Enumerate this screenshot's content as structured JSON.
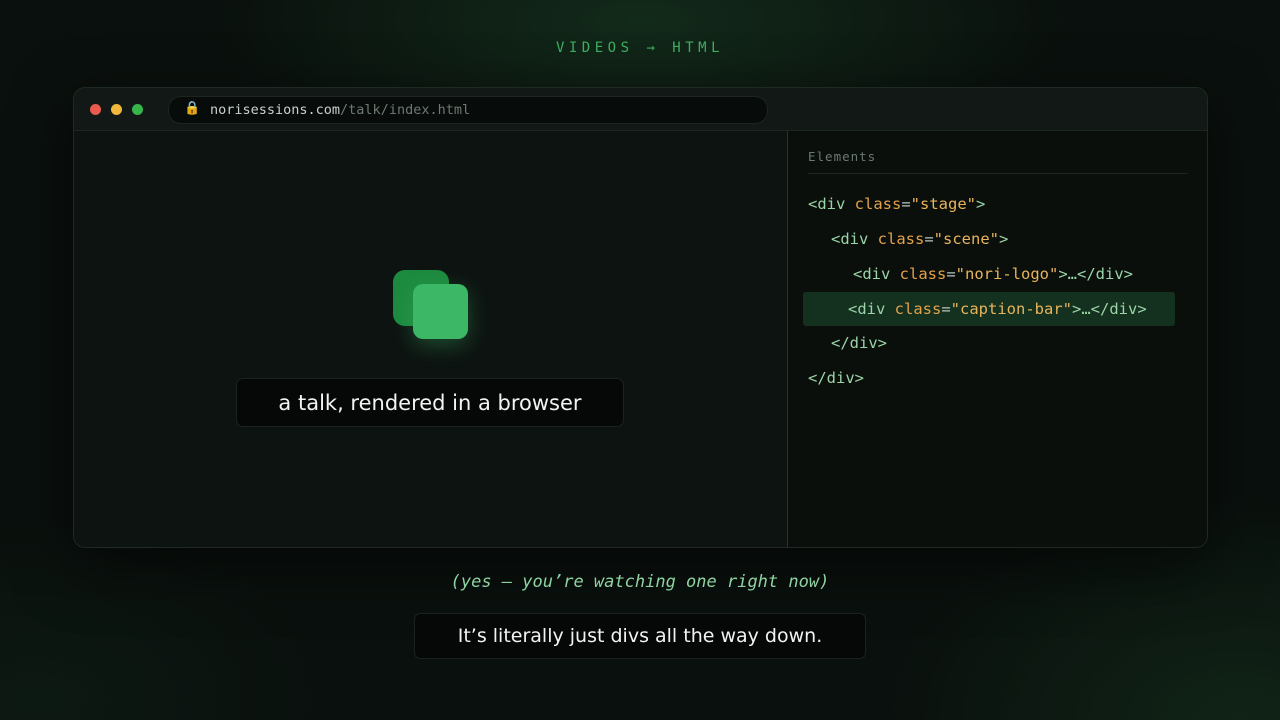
{
  "header": {
    "label": "VIDEOS → HTML"
  },
  "browser": {
    "url_host": "norisessions.com",
    "url_path": "/talk/index.html",
    "lock_icon": "lock-icon",
    "window_controls": [
      "close",
      "minimize",
      "maximize"
    ]
  },
  "viewport": {
    "logo_icon": "nori-logo-icon",
    "caption": "a talk, rendered in a browser"
  },
  "devtools": {
    "panel_label": "Elements",
    "lines": [
      {
        "open": "<div",
        "attr": " class",
        "eq": "=",
        "val": "\"stage\"",
        "close": ">"
      },
      {
        "open": "<div",
        "attr": " class",
        "eq": "=",
        "val": "\"scene\"",
        "close": ">"
      },
      {
        "open": "<div",
        "attr": " class",
        "eq": "=",
        "val": "\"nori-logo\"",
        "close": ">…</div>"
      },
      {
        "open": "<div",
        "attr": " class",
        "eq": "=",
        "val": "\"caption-bar\"",
        "close": ">…</div>"
      },
      {
        "close_tag": "</div>"
      },
      {
        "close_tag": "</div>"
      }
    ]
  },
  "footer": {
    "aside": "(yes — you’re watching one right now)",
    "caption": "It’s literally just divs all the way down."
  },
  "colors": {
    "accent": "#3cb766",
    "accent_dark": "#1d8a3f",
    "background": "#0a100d",
    "tag": "#9bd4a7",
    "attribute": "#e3a14a"
  }
}
